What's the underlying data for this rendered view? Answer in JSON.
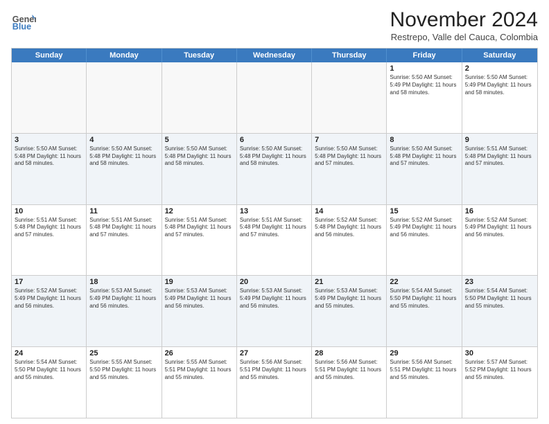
{
  "header": {
    "logo_line1": "General",
    "logo_line2": "Blue",
    "month": "November 2024",
    "location": "Restrepo, Valle del Cauca, Colombia"
  },
  "days_of_week": [
    "Sunday",
    "Monday",
    "Tuesday",
    "Wednesday",
    "Thursday",
    "Friday",
    "Saturday"
  ],
  "weeks": [
    [
      {
        "day": "",
        "info": ""
      },
      {
        "day": "",
        "info": ""
      },
      {
        "day": "",
        "info": ""
      },
      {
        "day": "",
        "info": ""
      },
      {
        "day": "",
        "info": ""
      },
      {
        "day": "1",
        "info": "Sunrise: 5:50 AM\nSunset: 5:49 PM\nDaylight: 11 hours and 58 minutes."
      },
      {
        "day": "2",
        "info": "Sunrise: 5:50 AM\nSunset: 5:49 PM\nDaylight: 11 hours and 58 minutes."
      }
    ],
    [
      {
        "day": "3",
        "info": "Sunrise: 5:50 AM\nSunset: 5:48 PM\nDaylight: 11 hours and 58 minutes."
      },
      {
        "day": "4",
        "info": "Sunrise: 5:50 AM\nSunset: 5:48 PM\nDaylight: 11 hours and 58 minutes."
      },
      {
        "day": "5",
        "info": "Sunrise: 5:50 AM\nSunset: 5:48 PM\nDaylight: 11 hours and 58 minutes."
      },
      {
        "day": "6",
        "info": "Sunrise: 5:50 AM\nSunset: 5:48 PM\nDaylight: 11 hours and 58 minutes."
      },
      {
        "day": "7",
        "info": "Sunrise: 5:50 AM\nSunset: 5:48 PM\nDaylight: 11 hours and 57 minutes."
      },
      {
        "day": "8",
        "info": "Sunrise: 5:50 AM\nSunset: 5:48 PM\nDaylight: 11 hours and 57 minutes."
      },
      {
        "day": "9",
        "info": "Sunrise: 5:51 AM\nSunset: 5:48 PM\nDaylight: 11 hours and 57 minutes."
      }
    ],
    [
      {
        "day": "10",
        "info": "Sunrise: 5:51 AM\nSunset: 5:48 PM\nDaylight: 11 hours and 57 minutes."
      },
      {
        "day": "11",
        "info": "Sunrise: 5:51 AM\nSunset: 5:48 PM\nDaylight: 11 hours and 57 minutes."
      },
      {
        "day": "12",
        "info": "Sunrise: 5:51 AM\nSunset: 5:48 PM\nDaylight: 11 hours and 57 minutes."
      },
      {
        "day": "13",
        "info": "Sunrise: 5:51 AM\nSunset: 5:48 PM\nDaylight: 11 hours and 57 minutes."
      },
      {
        "day": "14",
        "info": "Sunrise: 5:52 AM\nSunset: 5:48 PM\nDaylight: 11 hours and 56 minutes."
      },
      {
        "day": "15",
        "info": "Sunrise: 5:52 AM\nSunset: 5:49 PM\nDaylight: 11 hours and 56 minutes."
      },
      {
        "day": "16",
        "info": "Sunrise: 5:52 AM\nSunset: 5:49 PM\nDaylight: 11 hours and 56 minutes."
      }
    ],
    [
      {
        "day": "17",
        "info": "Sunrise: 5:52 AM\nSunset: 5:49 PM\nDaylight: 11 hours and 56 minutes."
      },
      {
        "day": "18",
        "info": "Sunrise: 5:53 AM\nSunset: 5:49 PM\nDaylight: 11 hours and 56 minutes."
      },
      {
        "day": "19",
        "info": "Sunrise: 5:53 AM\nSunset: 5:49 PM\nDaylight: 11 hours and 56 minutes."
      },
      {
        "day": "20",
        "info": "Sunrise: 5:53 AM\nSunset: 5:49 PM\nDaylight: 11 hours and 56 minutes."
      },
      {
        "day": "21",
        "info": "Sunrise: 5:53 AM\nSunset: 5:49 PM\nDaylight: 11 hours and 55 minutes."
      },
      {
        "day": "22",
        "info": "Sunrise: 5:54 AM\nSunset: 5:50 PM\nDaylight: 11 hours and 55 minutes."
      },
      {
        "day": "23",
        "info": "Sunrise: 5:54 AM\nSunset: 5:50 PM\nDaylight: 11 hours and 55 minutes."
      }
    ],
    [
      {
        "day": "24",
        "info": "Sunrise: 5:54 AM\nSunset: 5:50 PM\nDaylight: 11 hours and 55 minutes."
      },
      {
        "day": "25",
        "info": "Sunrise: 5:55 AM\nSunset: 5:50 PM\nDaylight: 11 hours and 55 minutes."
      },
      {
        "day": "26",
        "info": "Sunrise: 5:55 AM\nSunset: 5:51 PM\nDaylight: 11 hours and 55 minutes."
      },
      {
        "day": "27",
        "info": "Sunrise: 5:56 AM\nSunset: 5:51 PM\nDaylight: 11 hours and 55 minutes."
      },
      {
        "day": "28",
        "info": "Sunrise: 5:56 AM\nSunset: 5:51 PM\nDaylight: 11 hours and 55 minutes."
      },
      {
        "day": "29",
        "info": "Sunrise: 5:56 AM\nSunset: 5:51 PM\nDaylight: 11 hours and 55 minutes."
      },
      {
        "day": "30",
        "info": "Sunrise: 5:57 AM\nSunset: 5:52 PM\nDaylight: 11 hours and 55 minutes."
      }
    ]
  ]
}
